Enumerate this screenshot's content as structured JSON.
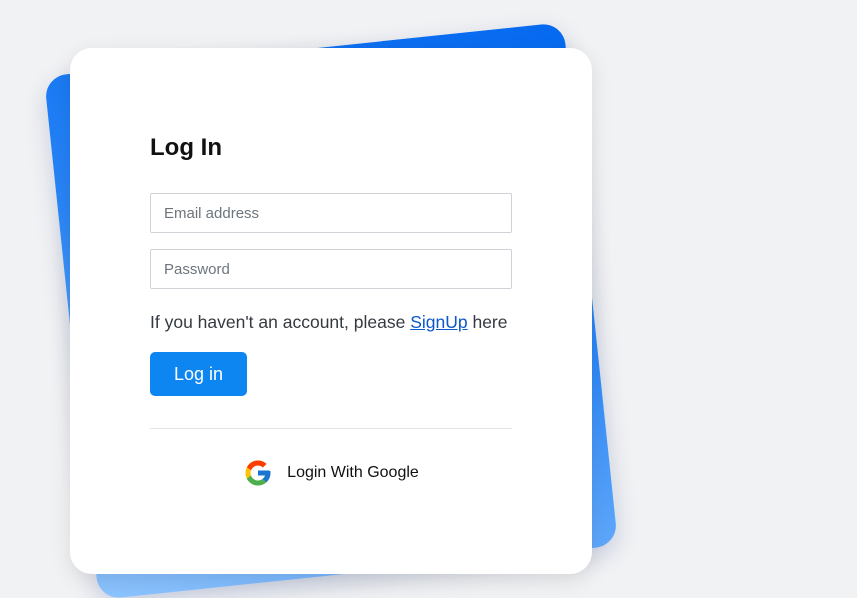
{
  "login": {
    "title": "Log In",
    "email": {
      "placeholder": "Email address",
      "value": ""
    },
    "password": {
      "placeholder": "Password",
      "value": ""
    },
    "signup": {
      "prefix": "If you haven't an account, please ",
      "link_label": "SignUp",
      "suffix": " here"
    },
    "submit_label": "Log in",
    "google": {
      "label": "Login With Google",
      "icon": "google-icon"
    }
  },
  "colors": {
    "background": "#f1f2f4",
    "card": "#ffffff",
    "accent": "#0d86f2",
    "link": "#0a58ca",
    "backdrop_gradient": [
      "#0569f0",
      "#8ec5ff"
    ]
  }
}
